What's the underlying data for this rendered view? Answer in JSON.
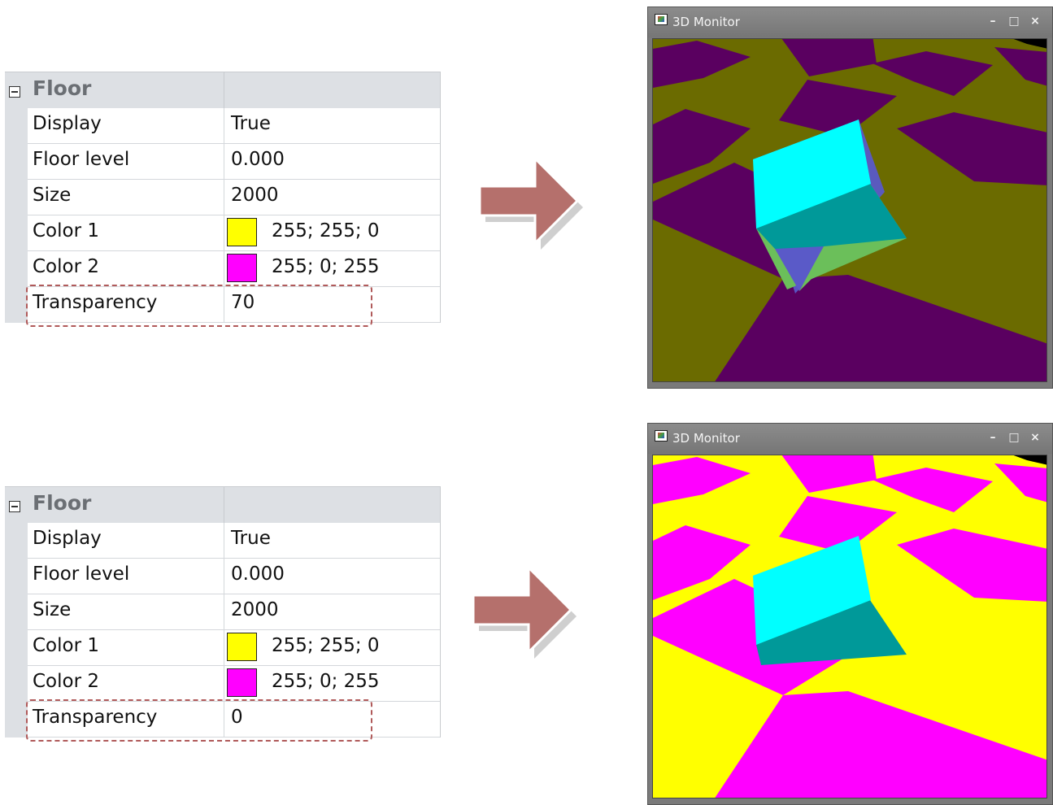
{
  "panels": [
    {
      "category": "Floor",
      "rows": [
        {
          "name": "Display",
          "value": "True"
        },
        {
          "name": "Floor level",
          "value": "0.000"
        },
        {
          "name": "Size",
          "value": "2000"
        },
        {
          "name": "Color 1",
          "value": "255; 255; 0",
          "swatch": "#ffff00"
        },
        {
          "name": "Color 2",
          "value": "255; 0; 255",
          "swatch": "#ff00ff"
        },
        {
          "name": "Transparency",
          "value": "70"
        }
      ],
      "monitor": {
        "title": "3D Monitor",
        "floor_color_1": "#6b6b00",
        "floor_color_2": "#5a0060",
        "cube_top": "#00ffff",
        "cube_side": "#009999"
      }
    },
    {
      "category": "Floor",
      "rows": [
        {
          "name": "Display",
          "value": "True"
        },
        {
          "name": "Floor level",
          "value": "0.000"
        },
        {
          "name": "Size",
          "value": "2000"
        },
        {
          "name": "Color 1",
          "value": "255; 255; 0",
          "swatch": "#ffff00"
        },
        {
          "name": "Color 2",
          "value": "255; 0; 255",
          "swatch": "#ff00ff"
        },
        {
          "name": "Transparency",
          "value": "0"
        }
      ],
      "monitor": {
        "title": "3D Monitor",
        "floor_color_1": "#ffff00",
        "floor_color_2": "#ff00ff",
        "cube_top": "#00ffff",
        "cube_side": "#009999"
      }
    }
  ],
  "window_buttons": {
    "minimize": "–",
    "maximize": "□",
    "close": "×"
  },
  "arrow_color": "#b5706c"
}
